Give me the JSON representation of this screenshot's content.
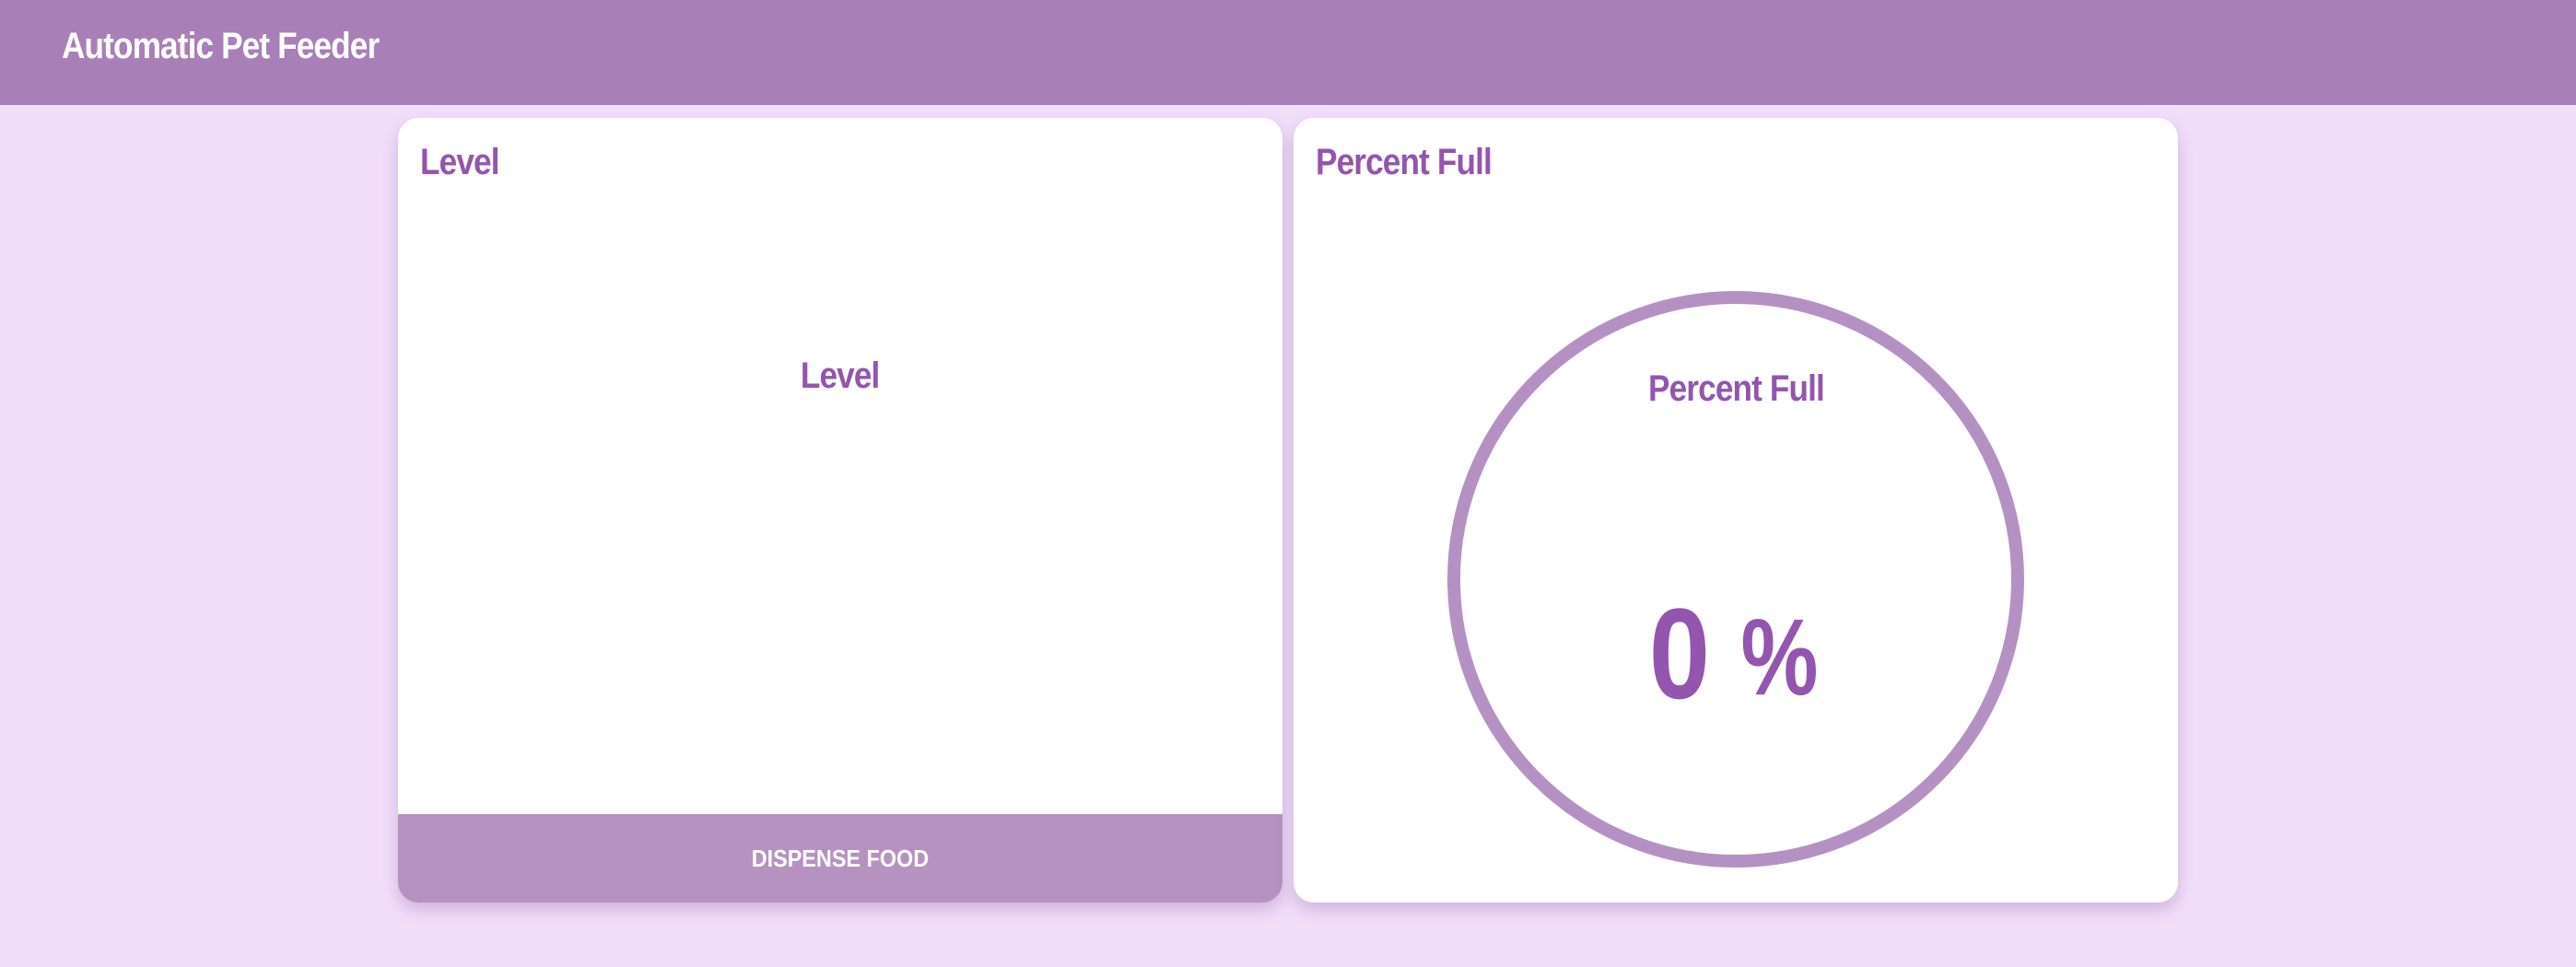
{
  "app": {
    "title": "Automatic Pet Feeder"
  },
  "level_card": {
    "title": "Level",
    "chart_title": "Level",
    "button_label": "DISPENSE FOOD"
  },
  "percent_card": {
    "title": "Percent Full",
    "gauge_title": "Percent Full",
    "value": "0",
    "unit": "%",
    "fill_fraction": 0
  },
  "colors": {
    "header_bg": "#a87fb6",
    "page_bg": "#f1dffa",
    "accent_text": "#9355ad",
    "button_bg": "#b592bf",
    "gauge_ring": "#b591c3"
  }
}
